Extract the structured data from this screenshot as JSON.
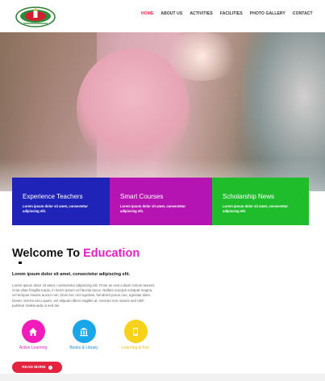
{
  "nav": {
    "items": [
      "HOME",
      "ABOUT US",
      "ACTIVITIES",
      "FACILITIES",
      "PHOTO GALLERY",
      "CONTACT"
    ],
    "active": "HOME"
  },
  "cards": [
    {
      "title": "Experience Teachers",
      "text": "Lorem ipsum dolor sit amet, consectetur adipiscing elit.",
      "color": "#1f23b7"
    },
    {
      "title": "Smart Courses",
      "text": "Lorem ipsum dolor sit amet, consectetur adipiscing elit.",
      "color": "#b514b3"
    },
    {
      "title": "Scholarship News",
      "text": "Lorem ipsum dolor sit amet, consectetur adipiscing elit.",
      "color": "#1fbd2c"
    }
  ],
  "welcome": {
    "title_prefix": "Welcome To",
    "title_highlight": "Education",
    "subhead": "Lorem ipsum dolor sit amet, consectetur adipiscing elit.",
    "body": "Lorem ipsum dolor sit amet, consectetur adipiscing elit. Proin ac erat a diam rutrum laoreet. Cras vitae fringilla turpis, in lorem ipsum vel lacinia lacus. Nullam suscipit volutpat magna, vel tempus mauris auctor non. Duis nec orci egestas, hendrerit purus non, egestas diam. Donec viverra arcu quam, vel aliquam libero sagittis at. Aenean non mauris sed nibh pulvinar malesuada ut sed dui."
  },
  "features": [
    {
      "label": "Active Learning",
      "icon": "home-icon",
      "color": "#f21cba"
    },
    {
      "label": "Books & Library",
      "icon": "library-icon",
      "color": "#19a7ea"
    },
    {
      "label": "Learning & Fun",
      "icon": "tablet-icon",
      "color": "#f7d21a"
    }
  ],
  "read_more": "READ MORE"
}
